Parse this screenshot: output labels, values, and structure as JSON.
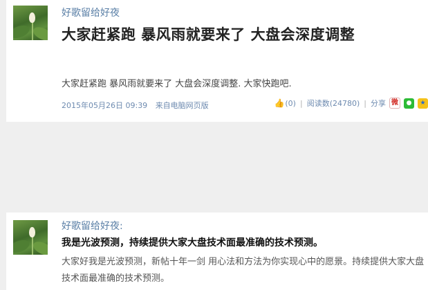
{
  "post1": {
    "author": "好歌留给好夜",
    "title": "大家赶紧跑  暴风雨就要来了  大盘会深度调整",
    "body": "大家赶紧跑  暴风雨就要来了  大盘会深度调整.  大家快跑吧.",
    "date": "2015年05月26日  09:39",
    "source": "来自电脑网页版",
    "likes": "(0)",
    "reads": "阅读数(24780)",
    "share_label": "分享"
  },
  "post2": {
    "author": "好歌留给好夜:",
    "title": "我是光波预测，持续提供大家大盘技术面最准确的技术预测。",
    "body": "大家好我是光波预测，新帖十年一剑  用心法和方法为你实现心中的愿景。持续提供大家大盘技术面最准确的技术预测。"
  },
  "icons": {
    "like": "thumbs-up-icon",
    "weibo": "weibo-icon",
    "wechat": "wechat-icon",
    "qzone": "qzone-icon"
  },
  "colors": {
    "link": "#5a7fa6",
    "meta": "#6e8bb0",
    "background": "#efefef",
    "wechat": "#2dbb36"
  }
}
